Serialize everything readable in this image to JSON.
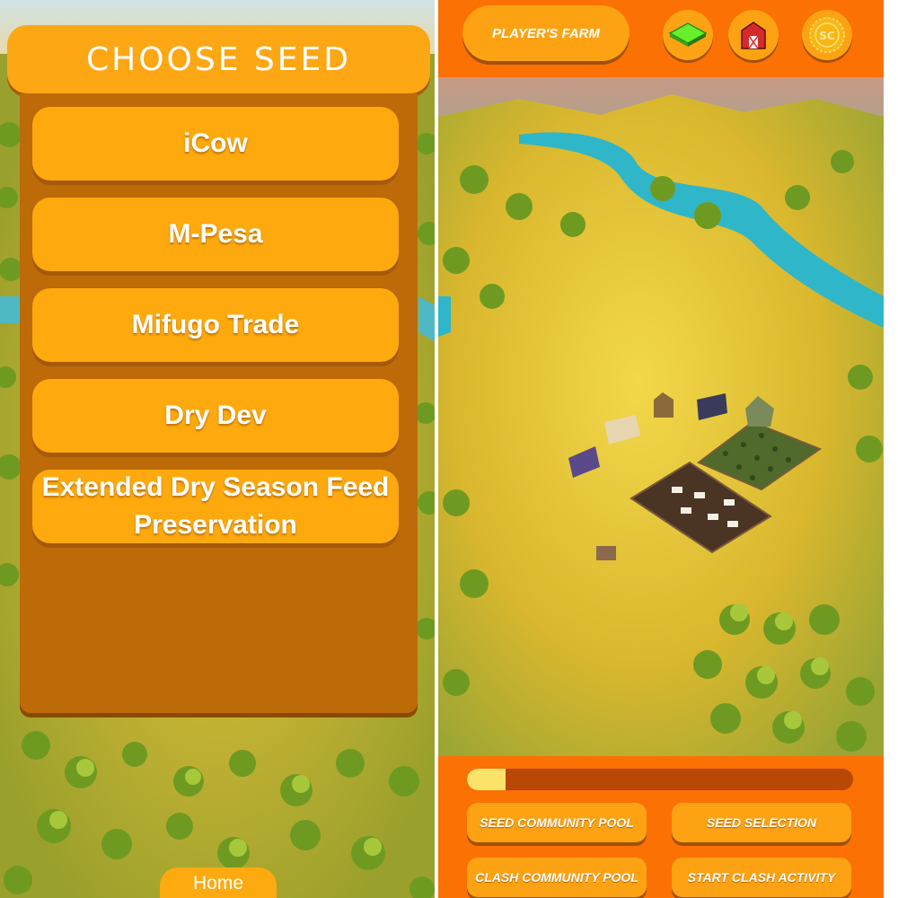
{
  "seed_menu": {
    "title": "CHOOSE SEED",
    "seeds": [
      {
        "label": "iCow"
      },
      {
        "label": "M-Pesa"
      },
      {
        "label": "Mifugo Trade"
      },
      {
        "label": "Dry Dev"
      },
      {
        "label": "Extended Dry Season Feed Preservation"
      }
    ],
    "home_label": "Home"
  },
  "farm_view": {
    "farm_title": "PLAYER'S FARM",
    "icons": [
      "land-tile-icon",
      "barn-icon",
      "coin-icon"
    ],
    "coin_text": "SC",
    "progress": 0.1,
    "buttons": {
      "seed_community_pool": "SEED COMMUNITY POOL",
      "seed_selection": "SEED SELECTION",
      "clash_community_pool": "CLASH COMMUNITY POOL",
      "start_clash_activity": "START CLASH ACTIVITY"
    }
  },
  "colors": {
    "accent_orange": "#fb7104",
    "button_orange": "#fda313",
    "panel_brown": "#bd6a09",
    "progress_fill": "#fbe36a"
  }
}
